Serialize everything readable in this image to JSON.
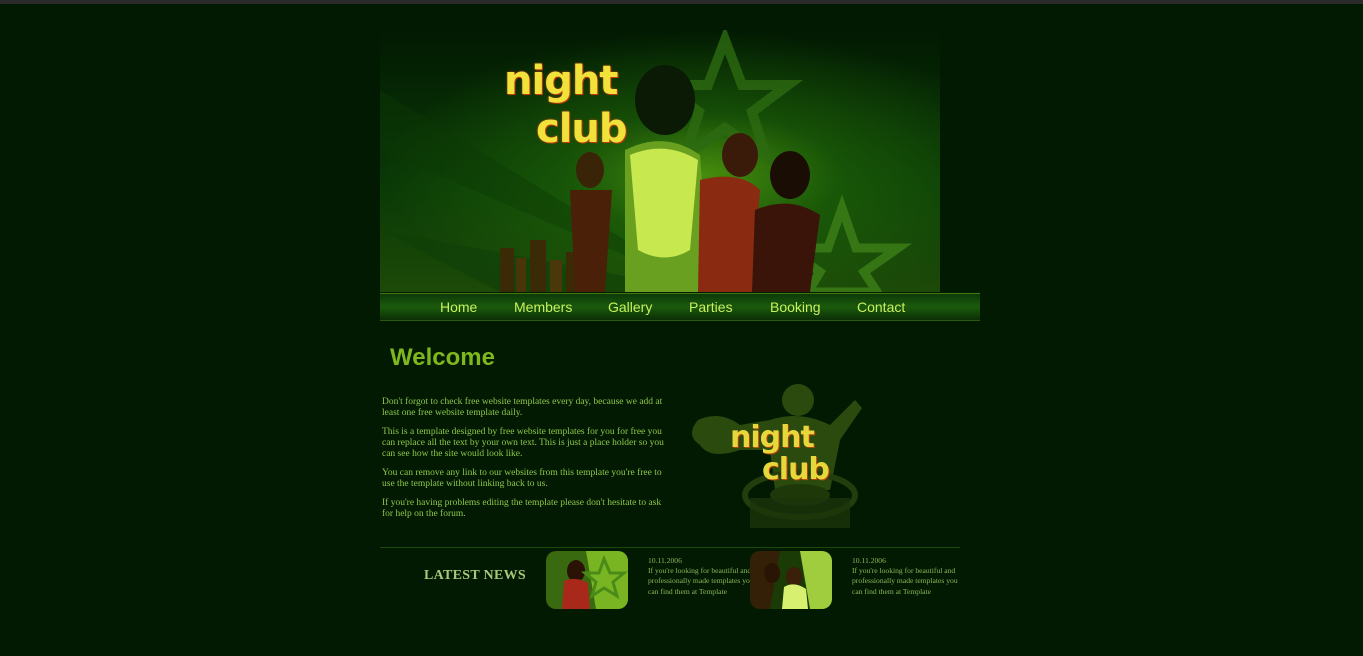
{
  "brand": {
    "line1": "night",
    "line2": "club"
  },
  "nav": {
    "items": [
      {
        "label": "Home"
      },
      {
        "label": "Members"
      },
      {
        "label": "Gallery"
      },
      {
        "label": "Parties"
      },
      {
        "label": "Booking"
      },
      {
        "label": "Contact"
      }
    ]
  },
  "main": {
    "title": "Welcome",
    "paragraphs": [
      "Don't forgot to check free website templates every day, because we add at least one free website template daily.",
      "This is a template designed by free website templates for you for free you can replace all the text by your own text. This is just a place holder so you can see how the site would look like.",
      "You can remove any link to our websites from this template you're free to use the template without linking back to us.",
      "If you're having problems editing the template please don't hesitate to ask for help on the forum."
    ],
    "side_logo": {
      "line1": "night",
      "line2": "club"
    }
  },
  "news": {
    "title": "LATEST NEWS",
    "items": [
      {
        "date": "10.11.2006",
        "text": "If you're looking for beautiful and professionally made templates you can find them at Template"
      },
      {
        "date": "10.11.2006",
        "text": "If you're looking for beautiful and professionally made templates you can find them at Template"
      }
    ]
  },
  "colors": {
    "background": "#021a02",
    "accent": "#7fb81e",
    "text": "#8fc84a",
    "nav_text": "#c8f060",
    "logo": "#f0e23a"
  }
}
